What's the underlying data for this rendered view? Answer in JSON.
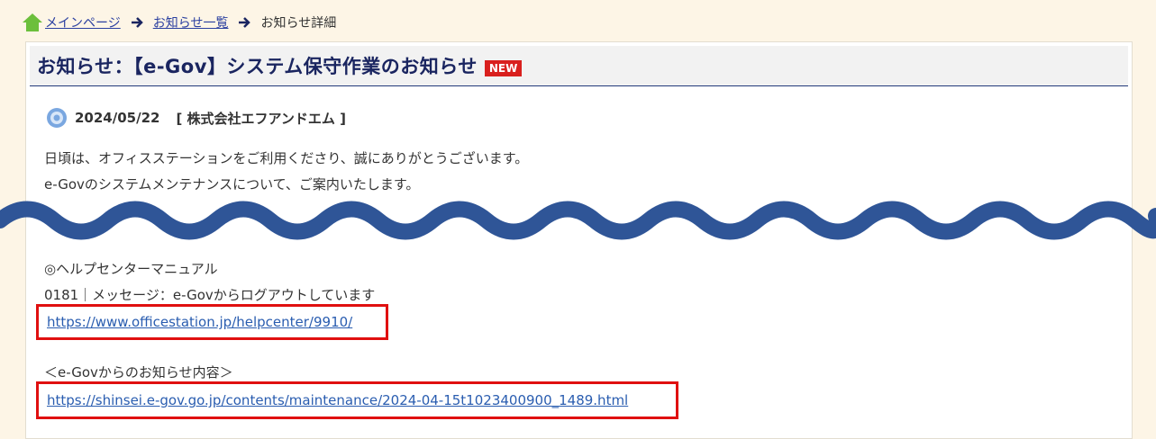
{
  "breadcrumb": {
    "home_label": "メインページ",
    "list_label": "お知らせ一覧",
    "current_label": "お知らせ詳細"
  },
  "notice": {
    "title": "お知らせ：【e-Gov】システム保守作業のお知らせ",
    "new_badge": "NEW",
    "date": "2024/05/22",
    "company": "[ 株式会社エフアンドエム ]",
    "line1": "日頃は、オフィスステーションをご利用くださり、誠にありがとうございます。",
    "line2": "e-Govのシステムメンテナンスについて、ご案内いたします。",
    "help_heading": "◎ヘルプセンターマニュアル",
    "help_item": "0181｜メッセージ：e-Govからログアウトしています",
    "help_link": "https://www.officestation.jp/helpcenter/9910/",
    "egov_heading": "＜e-Govからのお知らせ内容＞",
    "egov_link": "https://shinsei.e-gov.go.jp/contents/maintenance/2024-04-15t1023400900_1489.html"
  },
  "colors": {
    "title": "#1a2560",
    "badge": "#d9201e",
    "link": "#2a5db0",
    "wave": "#2f5597",
    "highlight": "#e01010"
  },
  "icons": [
    "home-icon",
    "arrow-right-icon",
    "gear-icon"
  ]
}
